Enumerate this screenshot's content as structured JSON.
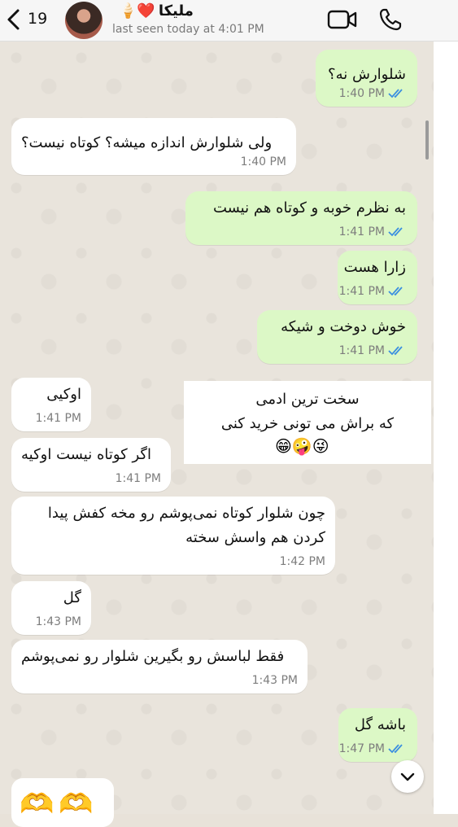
{
  "header": {
    "unread_count": "19",
    "contact_name": "ملیکا",
    "name_emojis": "🍦❤️",
    "status": "last seen today at 4:01 PM",
    "icons": [
      "back-chevron-icon",
      "video-call-icon",
      "phone-call-icon"
    ]
  },
  "messages": [
    {
      "dir": "out",
      "text": "شلوارش نه؟",
      "time": "1:40 PM",
      "read": true
    },
    {
      "dir": "in",
      "text": "ولی شلوارش اندازه میشه؟ کوتاه نیست؟",
      "time": "1:40 PM"
    },
    {
      "dir": "out",
      "text": "به نظرم خوبه و کوتاه هم نیست",
      "time": "1:41 PM",
      "read": true
    },
    {
      "dir": "out",
      "text": "زارا هست",
      "time": "1:41 PM",
      "read": true
    },
    {
      "dir": "out",
      "text": "خوش دوخت و شیکه",
      "time": "1:41 PM",
      "read": true
    },
    {
      "dir": "in",
      "text": "اوکیی",
      "time": "1:41 PM"
    },
    {
      "dir": "in",
      "text": "اگر کوتاه نیست اوکیه",
      "time": "1:41 PM"
    },
    {
      "dir": "in",
      "text": "چون شلوار کوتاه نمی‌پوشم رو مخه کفش پیدا کردن هم واسش سخته",
      "time": "1:42 PM"
    },
    {
      "dir": "in",
      "text": "گل",
      "time": "1:43 PM"
    },
    {
      "dir": "in",
      "text": "فقط لباسش رو بگیرین شلوار رو نمی‌پوشم",
      "time": "1:43 PM"
    },
    {
      "dir": "out",
      "text": "باشه گل",
      "time": "1:47 PM",
      "read": true
    }
  ],
  "sticker": {
    "line1": "سخت ترین ادمی",
    "line2": "که براش می تونی خرید کنی",
    "emojis": "😁🤪😜"
  },
  "partial_message": {
    "emojis": "🫶🫶"
  },
  "colors": {
    "outgoing_bubble": "#dcf8c6",
    "incoming_bubble": "#ffffff",
    "read_ticks": "#3b8fe0",
    "chat_bg": "#e9e4dc"
  }
}
